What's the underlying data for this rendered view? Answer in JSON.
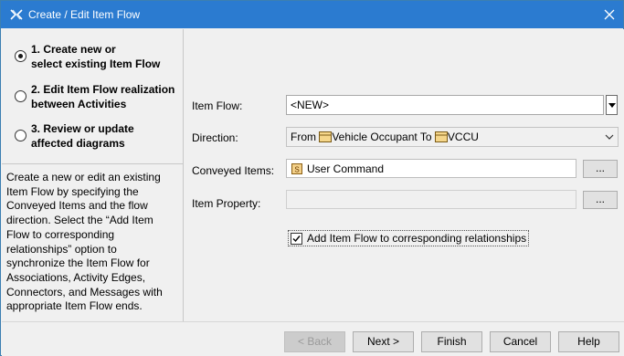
{
  "window": {
    "title": "Create / Edit Item Flow"
  },
  "steps": [
    {
      "label": "1. Create new or select existing Item Flow",
      "line1": "1. Create new or",
      "line2": "select existing Item Flow",
      "selected": true
    },
    {
      "label": "2. Edit Item Flow realization between Activities",
      "line1": "2. Edit Item Flow realization",
      "line2": "between Activities",
      "selected": false
    },
    {
      "label": "3. Review or update affected diagrams",
      "line1": "3. Review or update",
      "line2": "affected diagrams",
      "selected": false
    }
  ],
  "description": [
    "Create a new or edit an existing",
    "Item Flow by specifying the",
    "Conveyed Items and the flow",
    "direction. Select the “Add Item",
    "Flow to corresponding",
    "relationships” option to",
    "synchronize the Item Flow for",
    "Associations, Activity Edges,",
    "Connectors, and Messages with",
    "appropriate Item Flow ends."
  ],
  "form": {
    "item_flow": {
      "label": "Item Flow:",
      "value": "<NEW>"
    },
    "direction": {
      "label": "Direction:",
      "from_word": "From",
      "from": "Vehicle Occupant",
      "to_word": "To",
      "to": "VCCU"
    },
    "conveyed_items": {
      "label": "Conveyed Items:",
      "value": "User Command",
      "button": "..."
    },
    "item_property": {
      "label": "Item Property:",
      "value": "",
      "button": "..."
    },
    "add_to_relationships": {
      "label": "Add Item Flow to corresponding relationships",
      "checked": true
    }
  },
  "buttons": {
    "back": "< Back",
    "next": "Next >",
    "finish": "Finish",
    "cancel": "Cancel",
    "help": "Help"
  },
  "icons": {
    "app": "magicdraw-x-icon",
    "close": "close-icon",
    "class_icon": "block-class-icon",
    "signal_icon": "signal-icon"
  },
  "colors": {
    "titlebar": "#2b7bd0",
    "window_bg": "#f0f0f0"
  }
}
